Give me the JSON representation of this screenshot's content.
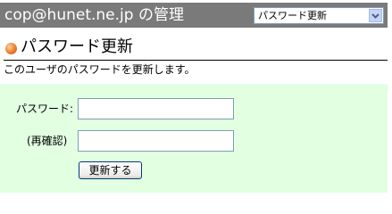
{
  "header": {
    "title": "cop@hunet.ne.jp の管理",
    "select_value": "パスワード更新"
  },
  "section": {
    "title": "パスワード更新",
    "description": "このユーザのパスワードを更新します。"
  },
  "form": {
    "password_label": "パスワード:",
    "password_value": "",
    "confirm_label": "(再確認)",
    "confirm_value": "",
    "submit_label": "更新する"
  },
  "colors": {
    "header_bg": "#7a7a7a",
    "panel_bg": "#e2ffe2",
    "bullet": "#f08a3a"
  }
}
